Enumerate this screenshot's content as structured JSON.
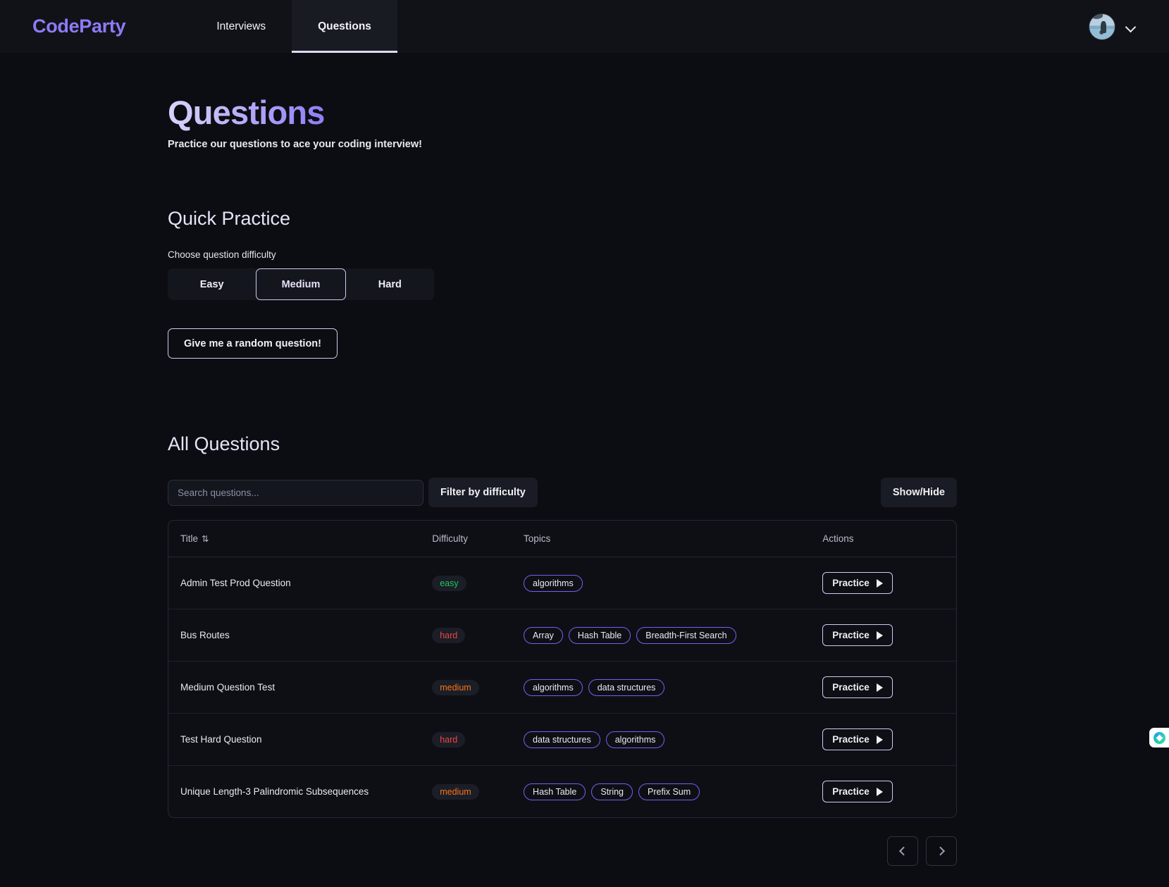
{
  "navbar": {
    "brand": "CodeParty",
    "tabs": [
      {
        "label": "Interviews",
        "active": false
      },
      {
        "label": "Questions",
        "active": true
      }
    ],
    "account_chevron": "chevron-down"
  },
  "header": {
    "title": "Questions",
    "subtitle": "Practice our questions to ace your coding interview!"
  },
  "quick_practice": {
    "title": "Quick Practice",
    "choose_label": "Choose question difficulty",
    "difficulties": [
      {
        "label": "Easy",
        "selected": false
      },
      {
        "label": "Medium",
        "selected": true
      },
      {
        "label": "Hard",
        "selected": false
      }
    ],
    "random_button": "Give me a random question!"
  },
  "all_questions": {
    "title": "All Questions",
    "search_placeholder": "Search questions...",
    "search_value": "",
    "filter_button": "Filter by difficulty",
    "showhide_button": "Show/Hide",
    "columns": {
      "title": "Title",
      "sort_glyph": "⇅",
      "difficulty": "Difficulty",
      "topics": "Topics",
      "actions": "Actions"
    },
    "action_label": "Practice",
    "rows": [
      {
        "title": "Admin Test Prod Question",
        "difficulty": "easy",
        "topics": [
          "algorithms"
        ]
      },
      {
        "title": "Bus Routes",
        "difficulty": "hard",
        "topics": [
          "Array",
          "Hash Table",
          "Breadth-First Search"
        ]
      },
      {
        "title": "Medium Question Test",
        "difficulty": "medium",
        "topics": [
          "algorithms",
          "data structures"
        ]
      },
      {
        "title": "Test Hard Question",
        "difficulty": "hard",
        "topics": [
          "data structures",
          "algorithms"
        ]
      },
      {
        "title": "Unique Length-3 Palindromic Subsequences",
        "difficulty": "medium",
        "topics": [
          "Hash Table",
          "String",
          "Prefix Sum"
        ]
      }
    ],
    "pagination": {
      "prev": "chevron-left",
      "next": "chevron-right"
    }
  },
  "colors": {
    "brand_purple": "#8b7cf6",
    "easy": "#22c55e",
    "medium": "#f97316",
    "hard": "#ef4444",
    "chip_border": "#7c5cf0",
    "background": "#0c0d12"
  }
}
